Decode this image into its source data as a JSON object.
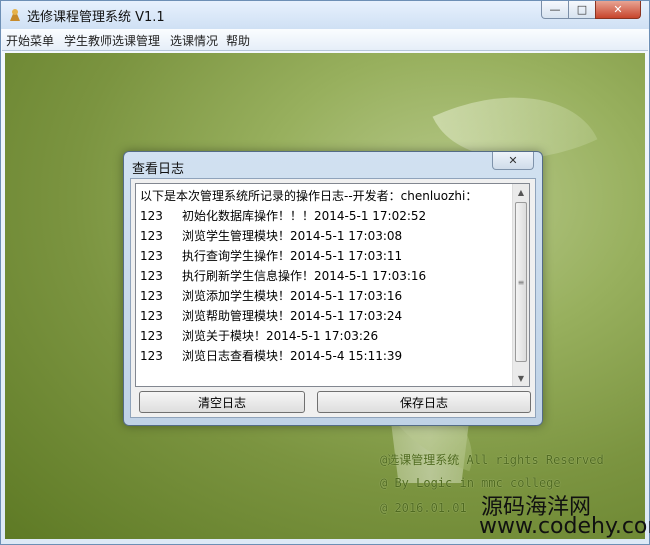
{
  "window": {
    "title": "选修课程管理系统 V1.1",
    "controls": {
      "minimize": "—",
      "maximize": "□",
      "close": "✕"
    }
  },
  "menubar": {
    "items": [
      "开始菜单",
      "学生教师选课管理",
      "选课情况",
      "帮助"
    ]
  },
  "dialog": {
    "title": "查看日志",
    "close": "✕",
    "header": "以下是本次管理系统所记录的操作日志--开发者：chenluozhi：",
    "entries": [
      {
        "id": "123",
        "text": "初始化数据库操作！！！2014-5-1 17:02:52"
      },
      {
        "id": "123",
        "text": "浏览学生管理模块！2014-5-1 17:03:08"
      },
      {
        "id": "123",
        "text": "执行查询学生操作！2014-5-1 17:03:11"
      },
      {
        "id": "123",
        "text": "执行刷新学生信息操作！2014-5-1 17:03:16"
      },
      {
        "id": "123",
        "text": "浏览添加学生模块！2014-5-1 17:03:16"
      },
      {
        "id": "123",
        "text": "浏览帮助管理模块！2014-5-1 17:03:24"
      },
      {
        "id": "123",
        "text": "浏览关于模块！2014-5-1 17:03:26"
      },
      {
        "id": "123",
        "text": "浏览日志查看模块！2014-5-4 15:11:39"
      }
    ],
    "buttons": {
      "clear": "清空日志",
      "save": "保存日志"
    }
  },
  "background": {
    "footer": [
      "@选课管理系统 All rights Reserved",
      "@ By Logic in mmc college",
      "@ 2016.01.01"
    ],
    "watermark": [
      "源码海洋网",
      "www.codehy.com"
    ]
  },
  "colors": {
    "desktop": "#7b9440",
    "titlebar": "#cfe0f4",
    "close": "#c7452c"
  }
}
